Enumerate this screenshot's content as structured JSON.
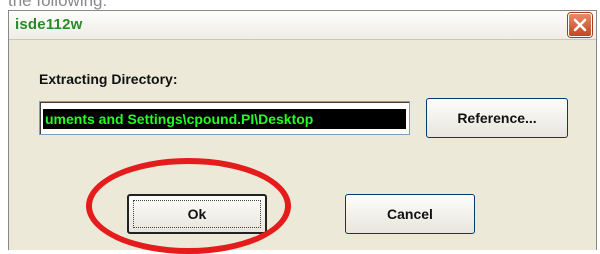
{
  "caption": "the following:",
  "dialog": {
    "title": "isde112w",
    "label": "Extracting Directory:",
    "path_value": "uments and Settings\\cpound.PI\\Desktop",
    "reference_button": "Reference...",
    "ok_button": "Ok",
    "cancel_button": "Cancel"
  },
  "colors": {
    "title_text": "#2a8a2a",
    "path_text": "#22ff22",
    "path_background": "#000000",
    "annotation_ring": "#e41c1c",
    "dialog_background": "#ece9d8"
  },
  "icons": {
    "close": "close-icon"
  }
}
